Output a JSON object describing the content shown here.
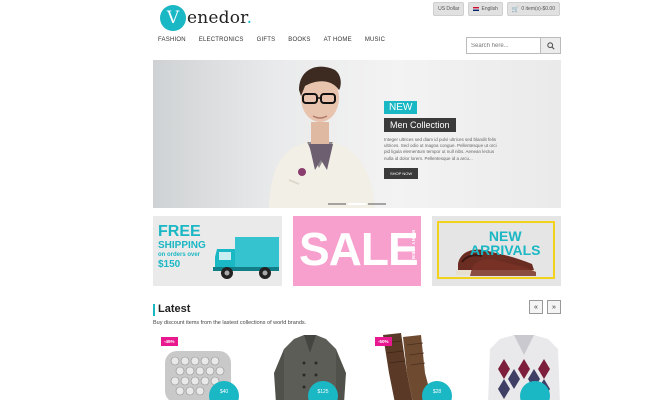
{
  "brand": {
    "logo_initial": "V",
    "logo_rest": "enedor",
    "logo_dot": ".",
    "accent_color": "#1ab7c4"
  },
  "topbar": {
    "currency": "US Dollar",
    "language": "English",
    "cart": "0 item(s)-$0.00"
  },
  "nav": {
    "items": [
      "FASHION",
      "ELECTRONICS",
      "GIFTS",
      "BOOKS",
      "AT HOME",
      "MUSIC"
    ]
  },
  "search": {
    "placeholder": "Search here...",
    "icon": "search-icon"
  },
  "hero": {
    "badge": "NEW",
    "title": "Men Collection",
    "description": "Integer ultrices sed diam id pulvi ultrices sed blandit felis ultrices. Sed odio ut magna congue. Pellentesque ut orci pid ligula elementum tempor ut null nibs. Aenean lectus nulla id dolor lorem. Pellentesque id a arcu...",
    "button": "SHOP NOW",
    "slide_count": 3,
    "active_slide": 1
  },
  "banners": {
    "shipping": {
      "free": "FREE",
      "shipping": "SHIPPING",
      "on_orders": "on orders over",
      "amount": "$150"
    },
    "sale": {
      "text": "SALE",
      "side": "MANY ITEMS"
    },
    "new_arrivals": {
      "line1": "NEW",
      "line2": "ARRIVALS",
      "frame_color": "#f2d21b"
    }
  },
  "latest": {
    "title": "Latest",
    "subtitle": "Buy discount items from the lastest collections of world brands.",
    "prev_icon": "chevron-left-icon",
    "next_icon": "chevron-right-icon",
    "prev_label": "«",
    "next_label": "»",
    "products": [
      {
        "badge": "-45%",
        "price": "$40"
      },
      {
        "badge": "",
        "price": "$125"
      },
      {
        "badge": "-50%",
        "price": "$28"
      },
      {
        "badge": "",
        "price": ""
      }
    ]
  }
}
